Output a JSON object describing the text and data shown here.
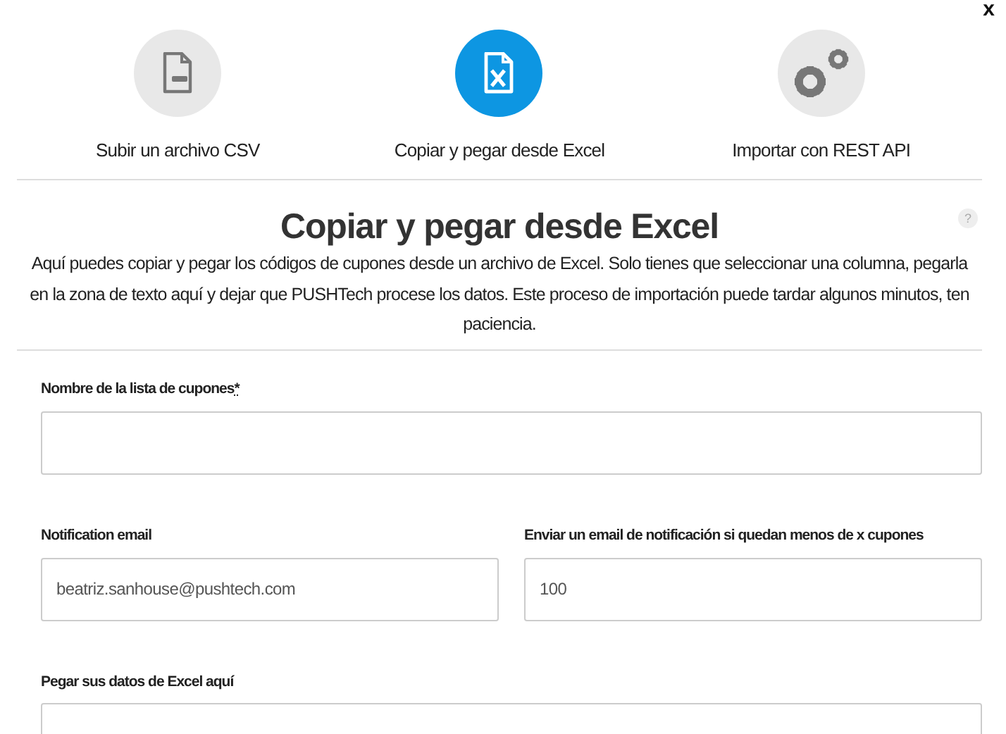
{
  "close": "x",
  "options": [
    {
      "label": "Subir un archivo CSV",
      "kind": "csv",
      "selected": false
    },
    {
      "label": "Copiar y pegar desde Excel",
      "kind": "excel",
      "selected": true
    },
    {
      "label": "Importar con REST API",
      "kind": "api",
      "selected": false
    }
  ],
  "title": "Copiar y pegar desde Excel",
  "help": "?",
  "description": "Aquí puedes copiar y pegar los códigos de cupones desde un archivo de Excel. Solo tienes que seleccionar una columna, pegarla en la zona de texto aquí y dejar que PUSHTech procese los datos. Este proceso de importación puede tardar algunos minutos, ten paciencia.",
  "form": {
    "list_name": {
      "label": "Nombre de la lista de cupones",
      "required_mark": "*"
    },
    "notification_email": {
      "label": "Notification email",
      "value": "beatriz.sanhouse@pushtech.com"
    },
    "threshold": {
      "label": "Enviar un email de notificación si quedan menos de x cupones",
      "value": "100"
    },
    "paste": {
      "label": "Pegar sus datos de Excel aquí"
    }
  }
}
